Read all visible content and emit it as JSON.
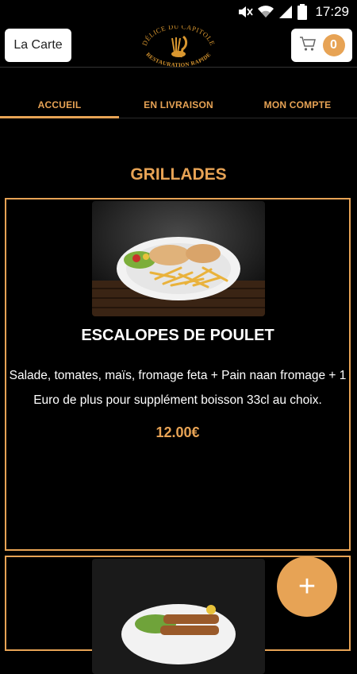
{
  "status_bar": {
    "time": "17:29",
    "icons": [
      "mute-icon",
      "wifi-icon",
      "signal-icon",
      "battery-icon"
    ]
  },
  "header": {
    "menu_label": "La Carte",
    "logo_text_top": "DÉLICE DU CAPITOLE",
    "logo_text_bottom": "RESTAURATION RAPIDE",
    "cart_count": "0"
  },
  "tabs": [
    {
      "label": "ACCUEIL",
      "active": true
    },
    {
      "label": "EN LIVRAISON",
      "active": false
    },
    {
      "label": "MON COMPTE",
      "active": false
    }
  ],
  "section": {
    "title": "GRILLADES"
  },
  "items": [
    {
      "name": "ESCALOPES DE POULET",
      "description_line1": "Salade, tomates, maïs, fromage feta + Pain naan fromage + 1",
      "description_line2": "Euro de plus pour supplément boisson 33cl au choix.",
      "price": "12.00€"
    }
  ],
  "colors": {
    "accent": "#E7A355",
    "background": "#000000",
    "text": "#FFFFFF"
  }
}
